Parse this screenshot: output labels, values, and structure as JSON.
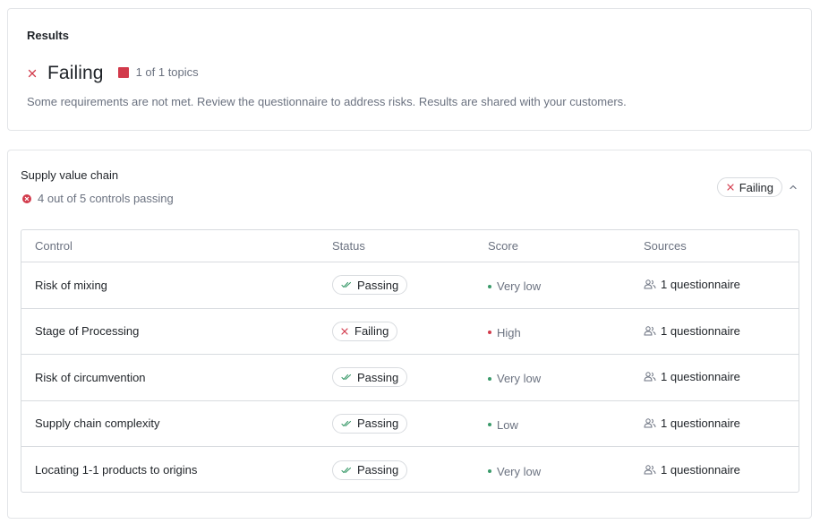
{
  "results": {
    "heading": "Results",
    "status": "Failing",
    "topics": "1 of 1 topics",
    "description": "Some requirements are not met. Review the questionnaire to address risks. Results are shared with your customers.",
    "colors": {
      "fail": "#d23a4b",
      "pass": "#3a9a6a",
      "muted": "#6b7280"
    }
  },
  "section": {
    "title": "Supply value chain",
    "summary": "4 out of 5 controls passing",
    "status": "Failing",
    "columns": [
      "Control",
      "Status",
      "Score",
      "Sources"
    ],
    "rows": [
      {
        "control": "Risk of mixing",
        "status": "Passing",
        "score": "Very low",
        "source": "1 questionnaire"
      },
      {
        "control": "Stage of Processing",
        "status": "Failing",
        "score": "High",
        "source": "1 questionnaire"
      },
      {
        "control": "Risk of circumvention",
        "status": "Passing",
        "score": "Very low",
        "source": "1 questionnaire"
      },
      {
        "control": "Supply chain complexity",
        "status": "Passing",
        "score": "Low",
        "source": "1 questionnaire"
      },
      {
        "control": "Locating 1-1 products to origins",
        "status": "Passing",
        "score": "Very low",
        "source": "1 questionnaire"
      }
    ]
  }
}
